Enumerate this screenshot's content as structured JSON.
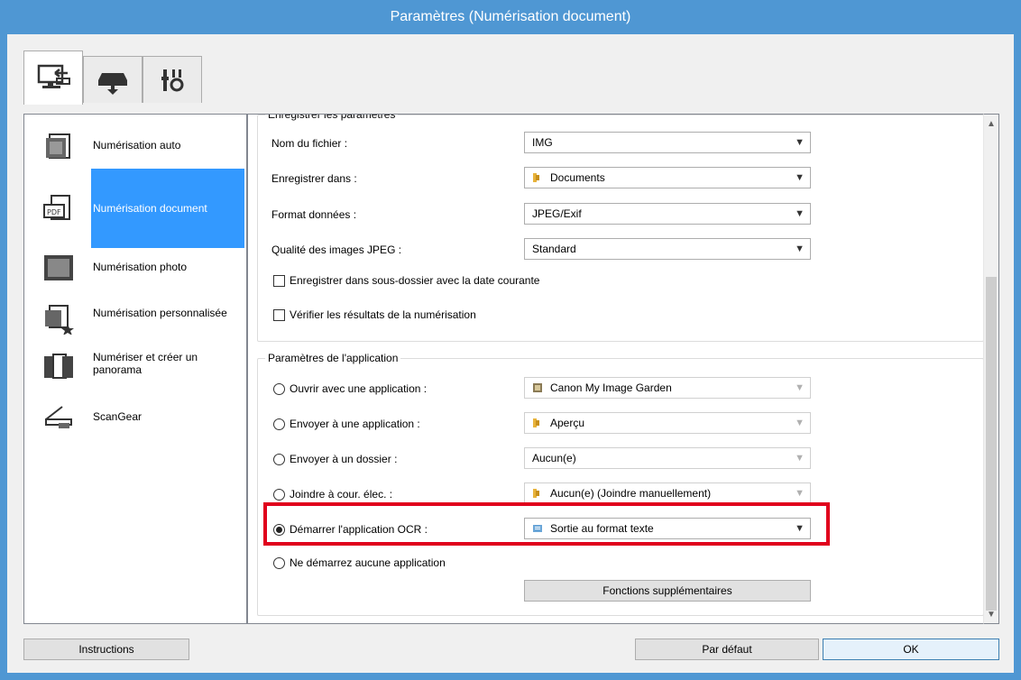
{
  "window": {
    "title": "Paramètres (Numérisation document)"
  },
  "tabs": [
    {
      "icon": "scan-from-computer-icon",
      "active": true
    },
    {
      "icon": "scan-from-panel-icon",
      "active": false
    },
    {
      "icon": "general-settings-icon",
      "active": false
    }
  ],
  "nav": {
    "items": [
      {
        "label": "Numérisation auto",
        "icon": "auto-scan-icon"
      },
      {
        "label": "Numérisation document",
        "icon": "document-scan-icon",
        "selected": true
      },
      {
        "label": "Numérisation photo",
        "icon": "photo-scan-icon"
      },
      {
        "label": "Numérisation personnalisée",
        "icon": "custom-scan-icon"
      },
      {
        "label": "Numériser et créer un panorama",
        "icon": "panorama-icon"
      },
      {
        "label": "ScanGear",
        "icon": "scangear-icon"
      }
    ]
  },
  "save_settings": {
    "legend": "Enregistrer les paramètres",
    "file_name_label": "Nom du fichier :",
    "file_name_value": "IMG",
    "save_in_label": "Enregistrer dans :",
    "save_in_value": "Documents",
    "data_format_label": "Format données :",
    "data_format_value": "JPEG/Exif",
    "jpeg_quality_label": "Qualité des images JPEG :",
    "jpeg_quality_value": "Standard",
    "subfolder_label": "Enregistrer dans sous-dossier avec la date courante",
    "check_results_label": "Vérifier les résultats de la numérisation"
  },
  "app_settings": {
    "legend": "Paramètres de l'application",
    "open_app_label": "Ouvrir avec une application :",
    "open_app_value": "Canon My Image Garden",
    "send_app_label": "Envoyer à une application :",
    "send_app_value": "Aperçu",
    "send_folder_label": "Envoyer à un dossier :",
    "send_folder_value": "Aucun(e)",
    "email_label": "Joindre à cour. élec. :",
    "email_value": "Aucun(e) (Joindre manuellement)",
    "ocr_label": "Démarrer l'application OCR :",
    "ocr_value": "Sortie au format texte",
    "none_label": "Ne démarrez aucune application",
    "more_functions": "Fonctions supplémentaires"
  },
  "footer": {
    "instructions": "Instructions",
    "defaults": "Par défaut",
    "ok": "OK"
  },
  "colors": {
    "title_bar": "#4f97d3",
    "selection": "#3399ff",
    "highlight": "#e0001c"
  }
}
